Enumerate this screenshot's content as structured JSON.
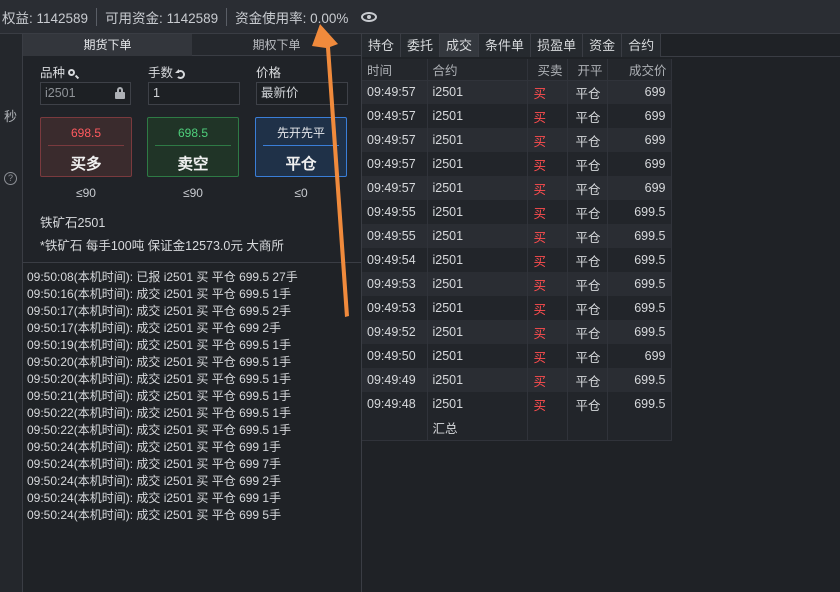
{
  "status_bar": {
    "equity": "权益: 1142589",
    "available": "可用资金: 1142589",
    "usage": "资金使用率: 0.00%"
  },
  "left_strip": {
    "label": "秒",
    "help": "?"
  },
  "order_panel": {
    "tabs": [
      "期货下单",
      "期权下单"
    ],
    "labels": {
      "symbol": "品种",
      "qty": "手数",
      "price": "价格"
    },
    "symbol_value": "i2501",
    "qty_value": "1",
    "price_value": "最新价",
    "buttons": {
      "buy": {
        "price": "698.5",
        "label": "买多"
      },
      "sell": {
        "price": "698.5",
        "label": "卖空"
      },
      "close": {
        "price": "先开先平",
        "label": "平仓"
      }
    },
    "limits": [
      "≤90",
      "≤90",
      "≤0"
    ],
    "instrument_name": "铁矿石2501",
    "instrument_desc": "*铁矿石 每手100吨 保证金12573.0元 大商所"
  },
  "log": [
    "09:50:08(本机时间): 已报 i2501 买 平仓 699.5 27手",
    "09:50:16(本机时间): 成交 i2501 买 平仓 699.5 1手",
    "09:50:17(本机时间): 成交 i2501 买 平仓 699.5 2手",
    "09:50:17(本机时间): 成交 i2501 买 平仓 699 2手",
    "09:50:19(本机时间): 成交 i2501 买 平仓 699.5 1手",
    "09:50:20(本机时间): 成交 i2501 买 平仓 699.5 1手",
    "09:50:20(本机时间): 成交 i2501 买 平仓 699.5 1手",
    "09:50:21(本机时间): 成交 i2501 买 平仓 699.5 1手",
    "09:50:22(本机时间): 成交 i2501 买 平仓 699.5 1手",
    "09:50:22(本机时间): 成交 i2501 买 平仓 699.5 1手",
    "09:50:24(本机时间): 成交 i2501 买 平仓 699 1手",
    "09:50:24(本机时间): 成交 i2501 买 平仓 699 7手",
    "09:50:24(本机时间): 成交 i2501 买 平仓 699 2手",
    "09:50:24(本机时间): 成交 i2501 买 平仓 699 1手",
    "09:50:24(本机时间): 成交 i2501 买 平仓 699 5手"
  ],
  "right_panel": {
    "tabs": [
      "持仓",
      "委托",
      "成交",
      "条件单",
      "损盈单",
      "资金",
      "合约"
    ],
    "active_tab": "成交",
    "columns": [
      "时间",
      "合约",
      "买卖",
      "开平",
      "成交价"
    ],
    "rows": [
      [
        "09:49:57",
        "i2501",
        "买",
        "平仓",
        "699"
      ],
      [
        "09:49:57",
        "i2501",
        "买",
        "平仓",
        "699"
      ],
      [
        "09:49:57",
        "i2501",
        "买",
        "平仓",
        "699"
      ],
      [
        "09:49:57",
        "i2501",
        "买",
        "平仓",
        "699"
      ],
      [
        "09:49:57",
        "i2501",
        "买",
        "平仓",
        "699"
      ],
      [
        "09:49:55",
        "i2501",
        "买",
        "平仓",
        "699.5"
      ],
      [
        "09:49:55",
        "i2501",
        "买",
        "平仓",
        "699.5"
      ],
      [
        "09:49:54",
        "i2501",
        "买",
        "平仓",
        "699.5"
      ],
      [
        "09:49:53",
        "i2501",
        "买",
        "平仓",
        "699.5"
      ],
      [
        "09:49:53",
        "i2501",
        "买",
        "平仓",
        "699.5"
      ],
      [
        "09:49:52",
        "i2501",
        "买",
        "平仓",
        "699.5"
      ],
      [
        "09:49:50",
        "i2501",
        "买",
        "平仓",
        "699"
      ],
      [
        "09:49:49",
        "i2501",
        "买",
        "平仓",
        "699.5"
      ],
      [
        "09:49:48",
        "i2501",
        "买",
        "平仓",
        "699.5"
      ]
    ],
    "summary_label": "汇总"
  },
  "colors": {
    "buy": "#ff4d4f",
    "sell": "#4fd07c",
    "accent": "#3a7ed8",
    "annotation": "#f08a3c"
  }
}
